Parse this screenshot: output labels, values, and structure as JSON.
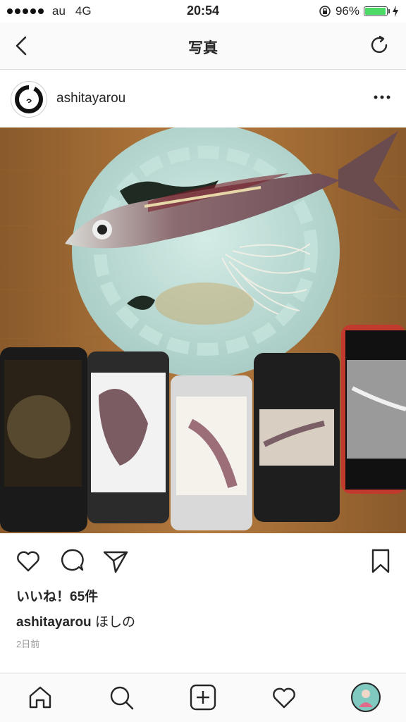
{
  "status_bar": {
    "carrier": "au",
    "network": "4G",
    "time": "20:54",
    "battery": "96%",
    "battery_level": 0.96
  },
  "nav": {
    "title": "写真",
    "back_icon": "chevron-left-icon",
    "refresh_icon": "refresh-icon"
  },
  "post": {
    "username": "ashitayarou",
    "likes": "いいね！65件",
    "caption_user": "ashitayarou",
    "caption_text": "ほしの",
    "time_ago": "2日前"
  },
  "colors": {
    "accent_battery": "#4cd964",
    "text": "#262626",
    "muted": "#999999",
    "border": "#dbdbdb"
  },
  "tab_bar": {
    "items": [
      "home-icon",
      "search-icon",
      "add-icon",
      "heart-icon",
      "profile-avatar"
    ]
  }
}
